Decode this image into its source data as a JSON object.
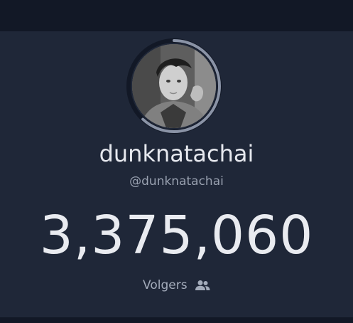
{
  "profile": {
    "display_name": "dunknatachai",
    "username": "@dunknatachai",
    "follower_count": "3,375,060",
    "followers_label": "Volgers",
    "followers_icon": "users-icon",
    "avatar_alt": "dunknatachai"
  },
  "colors": {
    "page_background": "#151b29",
    "card_background": "#1f2738",
    "ring_track": "#121826",
    "ring_progress": "#8a93a6",
    "text_primary": "#e6e8ee",
    "text_secondary": "#9aa2b1"
  },
  "progress_ring": {
    "fraction": 0.62
  }
}
